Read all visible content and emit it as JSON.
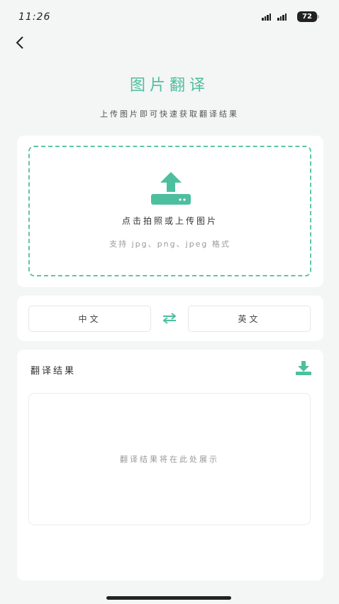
{
  "status_bar": {
    "time": "11:26",
    "battery": "72"
  },
  "header": {
    "back_icon": "chevron-left-icon",
    "title": "图片翻译",
    "subtitle": "上传图片即可快速获取翻译结果"
  },
  "upload": {
    "icon": "upload-icon",
    "label": "点击拍照或上传图片",
    "hint": "支持 jpg、png、jpeg 格式"
  },
  "language": {
    "source": "中文",
    "target": "英文",
    "swap_icon": "swap-arrows-icon"
  },
  "result": {
    "title": "翻译结果",
    "download_icon": "download-icon",
    "placeholder": "翻译结果将在此处展示"
  },
  "colors": {
    "accent": "#4dbf9f",
    "background": "#f4f5f5",
    "card": "#ffffff"
  }
}
